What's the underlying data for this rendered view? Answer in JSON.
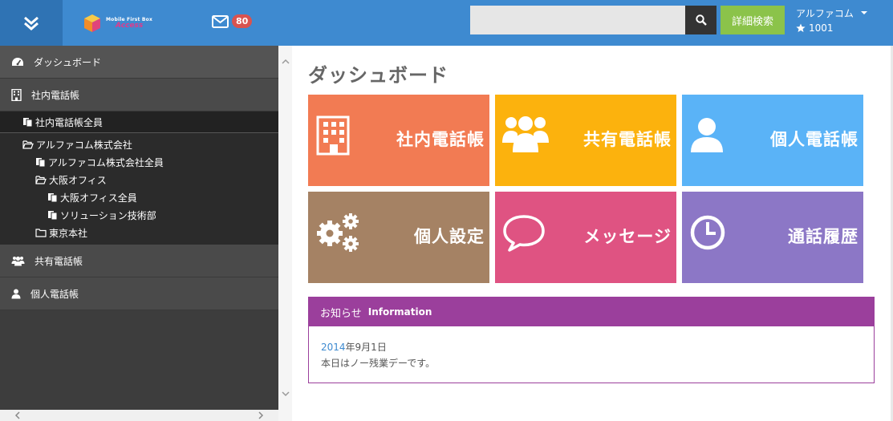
{
  "header": {
    "logo_line1": "Mobile First Box",
    "logo_line2": "Access",
    "mail_count": "80",
    "search_placeholder": "",
    "advanced_search_label": "詳細検索",
    "user_name": "アルファコム",
    "user_extension": "1001"
  },
  "sidebar": {
    "items": [
      {
        "label": "ダッシュボード",
        "icon": "dashboard-icon"
      },
      {
        "label": "社内電話帳",
        "icon": "building-icon"
      },
      {
        "label": "共有電話帳",
        "icon": "users-icon"
      },
      {
        "label": "個人電話帳",
        "icon": "user-icon"
      }
    ],
    "tree": [
      {
        "label": "社内電話帳全員",
        "icon": "file-copy-icon"
      },
      {
        "label": "アルファコム株式会社",
        "icon": "folder-open-icon"
      },
      {
        "label": "アルファコム株式会社全員",
        "icon": "file-copy-icon"
      },
      {
        "label": "大阪オフィス",
        "icon": "folder-open-icon"
      },
      {
        "label": "大阪オフィス全員",
        "icon": "file-copy-icon"
      },
      {
        "label": "ソリューション技術部",
        "icon": "file-copy-icon"
      },
      {
        "label": "東京本社",
        "icon": "folder-icon"
      }
    ]
  },
  "main": {
    "title": "ダッシュボード",
    "tiles": [
      {
        "label": "社内電話帳",
        "color": "#f27b53",
        "icon": "building-icon"
      },
      {
        "label": "共有電話帳",
        "color": "#fcb20d",
        "icon": "users-icon"
      },
      {
        "label": "個人電話帳",
        "color": "#5ab3f7",
        "icon": "user-icon"
      },
      {
        "label": "個人設定",
        "color": "#a58264",
        "icon": "gears-icon"
      },
      {
        "label": "メッセージ",
        "color": "#df5382",
        "icon": "speech-bubble-icon"
      },
      {
        "label": "通話履歴",
        "color": "#8c77c6",
        "icon": "clock-icon"
      }
    ],
    "info": {
      "title": "お知らせ",
      "subtitle": "Information",
      "date_year": "2014",
      "date_rest": "年9月1日",
      "message": "本日はノー残業デーです。"
    }
  },
  "colors": {
    "header": "#3e8ad0",
    "header_toggle": "#2f73b4",
    "advanced_button": "#8bc34a",
    "info_accent": "#9b3f9c",
    "badge": "#d9534f"
  }
}
